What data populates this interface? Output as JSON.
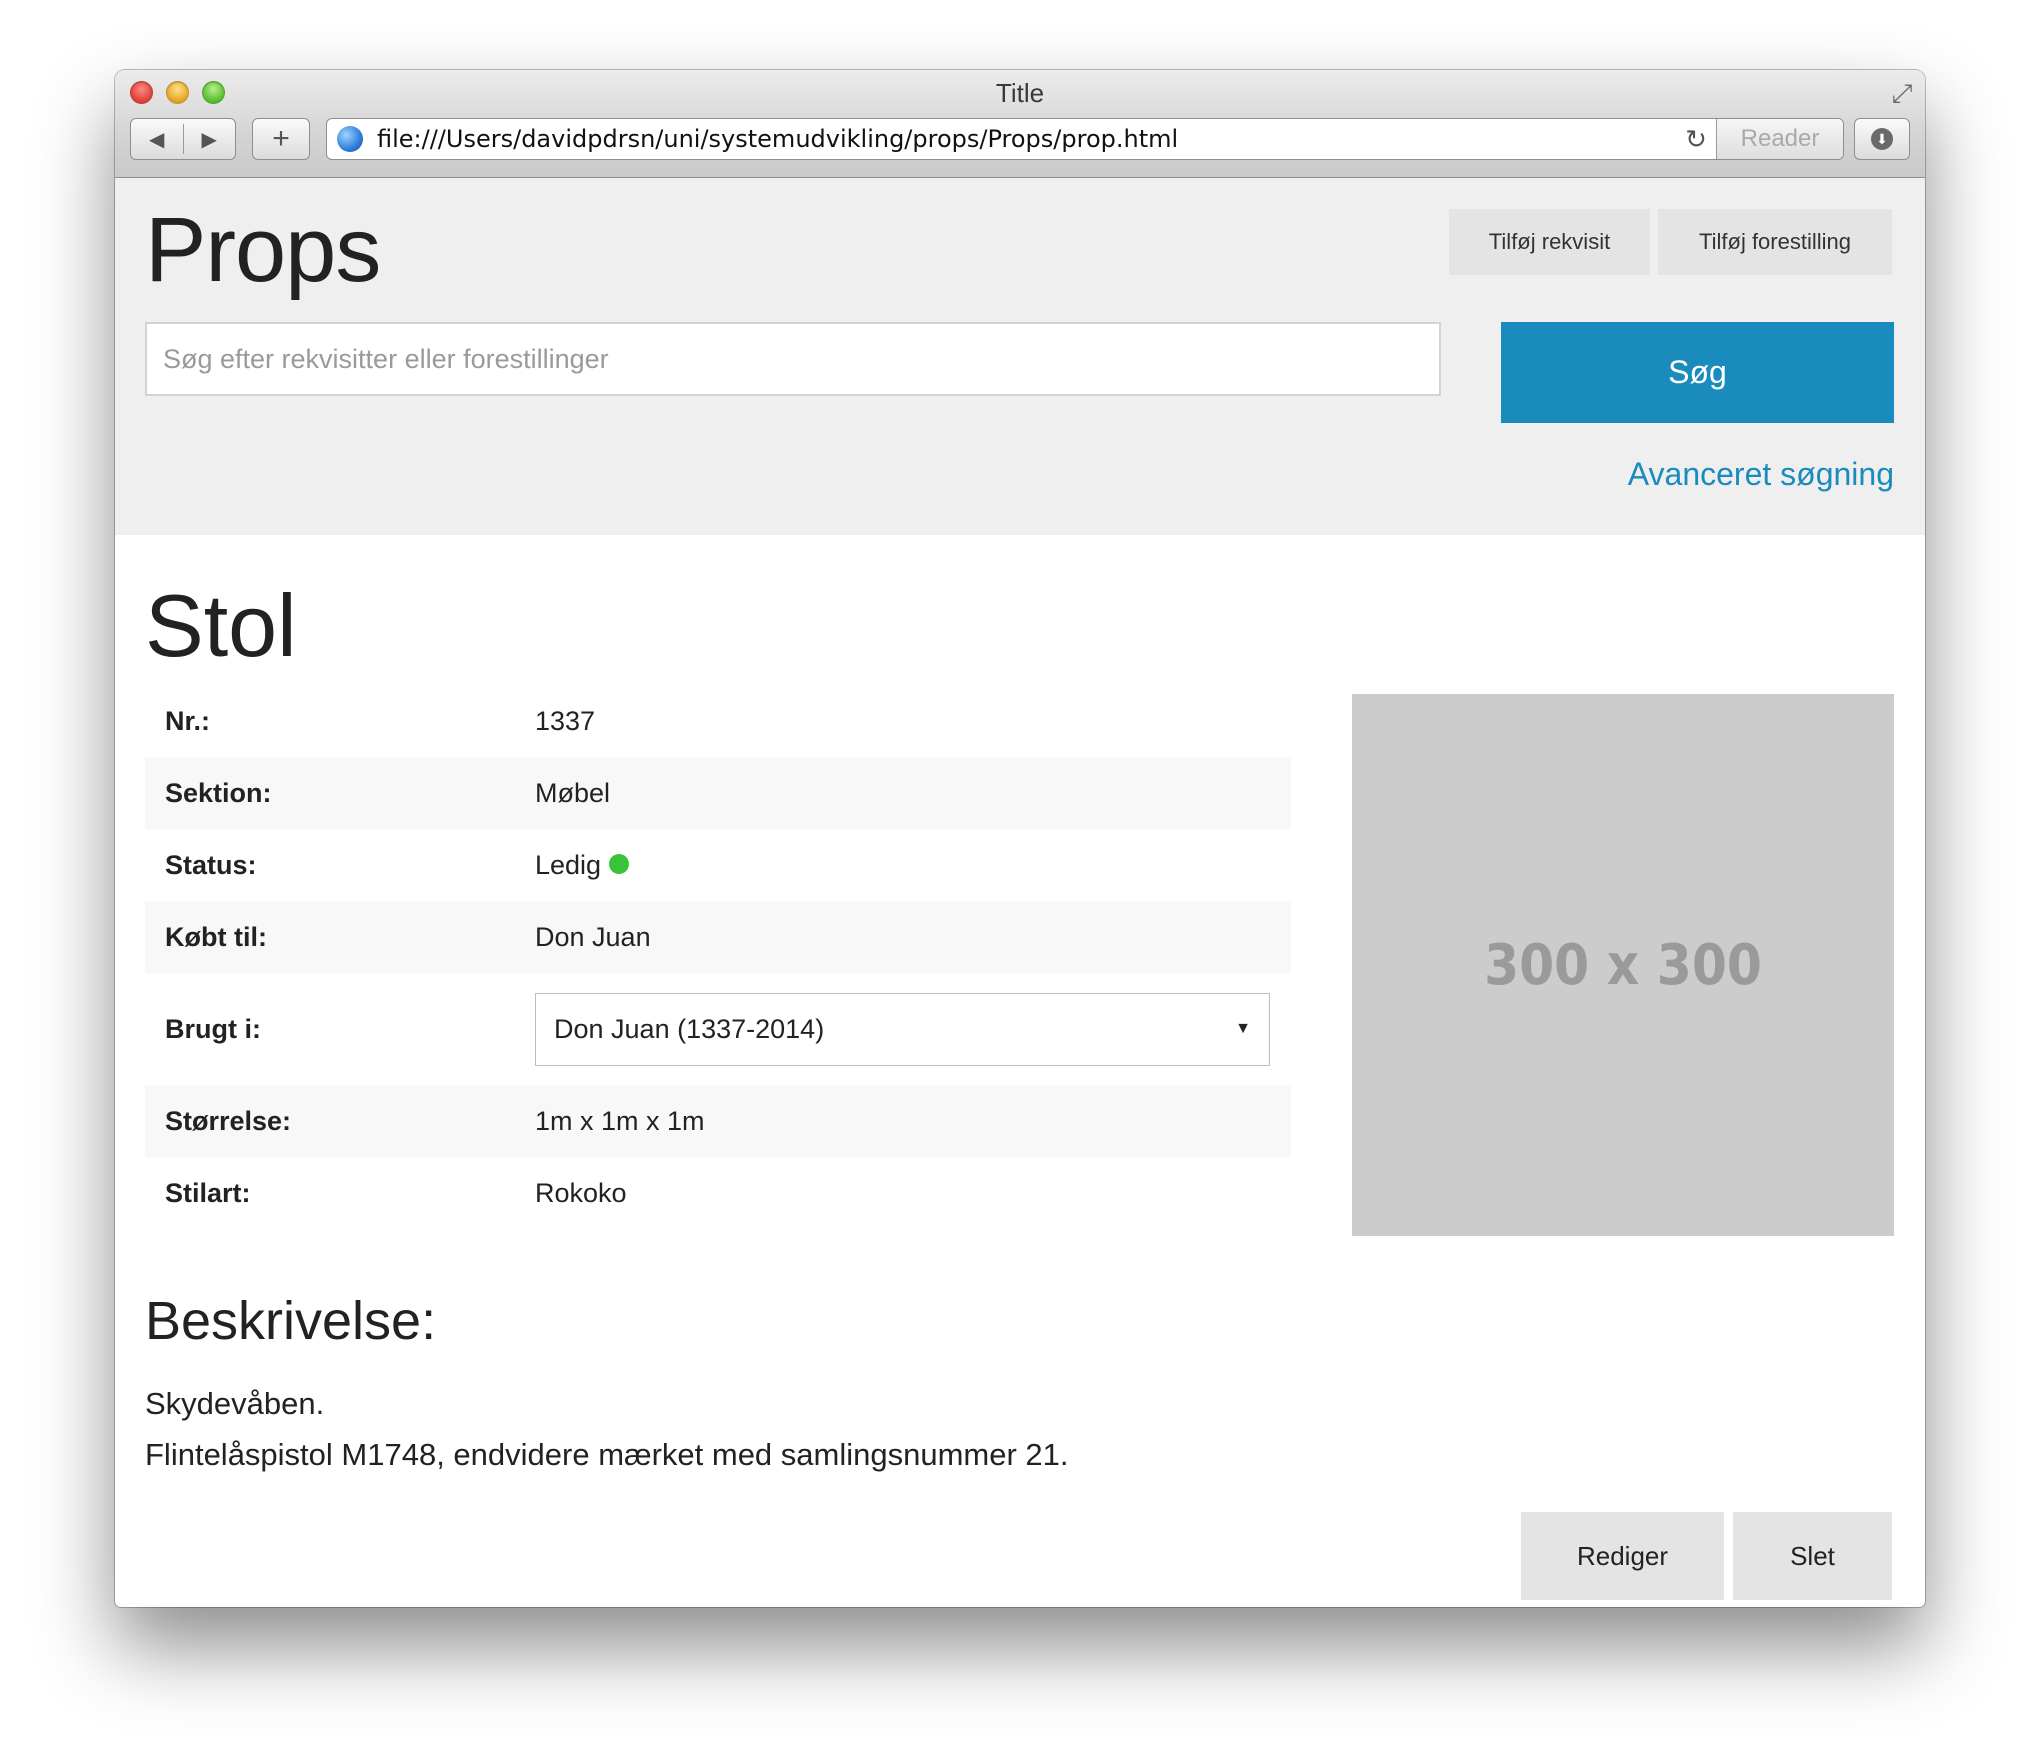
{
  "window": {
    "title": "Title",
    "url": "file:///Users/davidpdrsn/uni/systemudvikling/props/Props/prop.html",
    "reader_label": "Reader",
    "back_glyph": "◀",
    "forward_glyph": "▶",
    "plus_glyph": "+",
    "reload_glyph": "↻",
    "download_glyph": "⬇",
    "fullscreen_glyph": "⤢"
  },
  "header": {
    "brand": "Props",
    "add_prop_label": "Tilføj rekvisit",
    "add_show_label": "Tilføj forestilling",
    "search_placeholder": "Søg efter rekvisitter eller forestillinger",
    "search_button": "Søg",
    "advanced_link": "Avanceret søgning"
  },
  "prop": {
    "title": "Stol",
    "rows": [
      {
        "label": "Nr.:",
        "value": "1337"
      },
      {
        "label": "Sektion:",
        "value": "Møbel"
      },
      {
        "label": "Status:",
        "value": "Ledig"
      },
      {
        "label": "Købt til:",
        "value": "Don Juan"
      },
      {
        "label": "Brugt i:",
        "value": "Don Juan (1337-2014)"
      },
      {
        "label": "Størrelse:",
        "value": "1m x 1m x 1m"
      },
      {
        "label": "Stilart:",
        "value": "Rokoko"
      }
    ],
    "status_color": "#3ac33a",
    "image_placeholder": "300 x 300",
    "description_heading": "Beskrivelse:",
    "description_lines": [
      "Skydevåben.",
      "Flintelåspistol M1748, endvidere mærket med samlingsnummer 21."
    ],
    "edit_label": "Rediger",
    "delete_label": "Slet"
  },
  "colors": {
    "accent": "#1a8bbd",
    "header_bg": "#efefef",
    "button_bg": "#e4e4e4"
  }
}
